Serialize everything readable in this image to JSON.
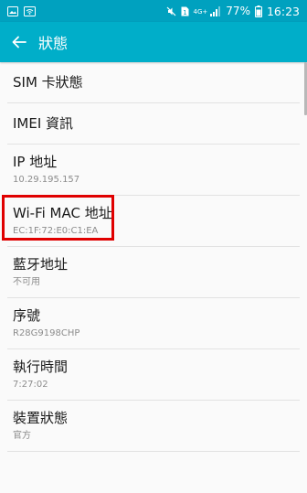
{
  "status_bar": {
    "network_type": "4G+",
    "sim_slot": "1",
    "battery": "77%",
    "time": "16:23",
    "icons": [
      "image-icon",
      "wifi-icon",
      "mute-icon",
      "sim-icon",
      "signal-icon",
      "battery-icon"
    ]
  },
  "app_bar": {
    "title": "狀態",
    "back_icon": "back-arrow-icon"
  },
  "items": [
    {
      "title": "SIM 卡狀態",
      "subtitle": ""
    },
    {
      "title": "IMEI 資訊",
      "subtitle": ""
    },
    {
      "title": "IP 地址",
      "subtitle": "10.29.195.157"
    },
    {
      "title": "Wi-Fi MAC 地址",
      "subtitle": "EC:1F:72:E0:C1:EA"
    },
    {
      "title": "藍牙地址",
      "subtitle": "不可用"
    },
    {
      "title": "序號",
      "subtitle": "R28G9198CHP"
    },
    {
      "title": "執行時間",
      "subtitle": "7:27:02"
    },
    {
      "title": "裝置狀態",
      "subtitle": "官方"
    }
  ],
  "colors": {
    "status_bar": "#00a1bf",
    "app_bar": "#00aec9",
    "highlight": "#e00000"
  }
}
